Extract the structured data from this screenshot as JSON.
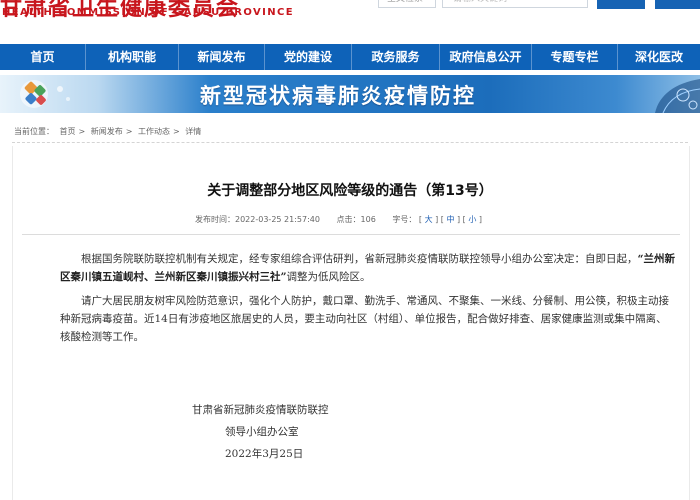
{
  "header": {
    "logo_cn": "甘肃省卫生健康委员会",
    "logo_en": "HEALTH COMMISSION OF GANSU PROVINCE",
    "search_scope": "全文检索",
    "search_placeholder": "请输入关键词"
  },
  "nav": {
    "items": [
      "首页",
      "机构职能",
      "新闻发布",
      "党的建设",
      "政务服务",
      "政府信息公开",
      "专题专栏",
      "深化医改"
    ]
  },
  "banner": {
    "title": "新型冠状病毒肺炎疫情防控"
  },
  "breadcrumb": {
    "label": "当前位置：",
    "items": [
      "首页",
      "新闻发布",
      "工作动态",
      "详情"
    ]
  },
  "article": {
    "title": "关于调整部分地区风险等级的通告（第13号）",
    "meta": {
      "date_label": "发布时间：",
      "date": "2022-03-25 21:57:40",
      "views_label": "点击：",
      "views": "106",
      "font_label": "字号：",
      "font_large": "大",
      "font_medium": "中",
      "font_small": "小"
    },
    "p1_before": "根据国务院联防联控机制有关规定，经专家组综合评估研判，省新冠肺炎疫情联防联控领导小组办公室决定：自即日起，",
    "p1_emph": "“兰州新区秦川镇五道岘村、兰州新区秦川镇振兴村三社”",
    "p1_after": "调整为低风险区。",
    "p2": "请广大居民朋友树牢风险防范意识，强化个人防护，戴口罩、勤洗手、常通风、不聚集、一米线、分餐制、用公筷，积极主动接种新冠病毒疫苗。近14日有涉疫地区旅居史的人员，要主动向社区（村组）、单位报告，配合做好排查、居家健康监测或集中隔离、核酸检测等工作。",
    "sign_org1": "甘肃省新冠肺炎疫情联防联控",
    "sign_org2": "领导小组办公室",
    "sign_date": "2022年3月25日"
  }
}
